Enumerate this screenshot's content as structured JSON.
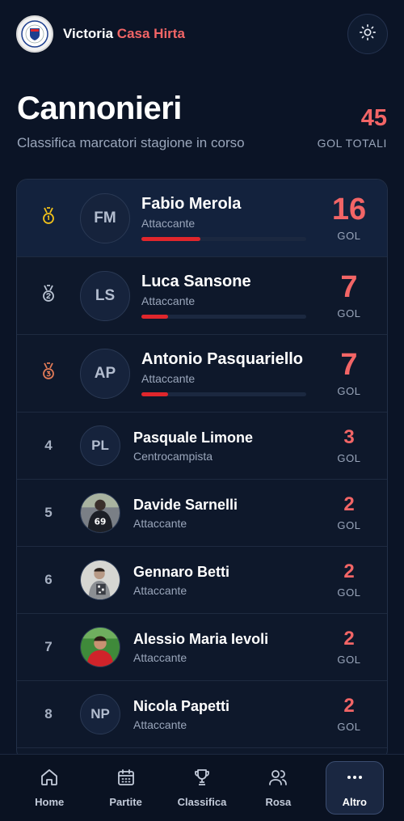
{
  "header": {
    "brand_part1": "Victoria",
    "brand_part2": "Casa Hirta",
    "logo_icon": "club-crest",
    "theme_icon": "sun-icon"
  },
  "page": {
    "title": "Cannonieri",
    "subtitle": "Classifica marcatori stagione in corso",
    "total_value": "45",
    "total_label": "GOL TOTALI"
  },
  "scorers": [
    {
      "rank": "1",
      "medal": "gold",
      "initials": "FM",
      "name": "Fabio Merola",
      "role": "Attaccante",
      "goals": "16",
      "goal_label": "GOL",
      "progress": 0.36
    },
    {
      "rank": "2",
      "medal": "silver",
      "initials": "LS",
      "name": "Luca Sansone",
      "role": "Attaccante",
      "goals": "7",
      "goal_label": "GOL",
      "progress": 0.16
    },
    {
      "rank": "3",
      "medal": "bronze",
      "initials": "AP",
      "name": "Antonio Pasquariello",
      "role": "Attaccante",
      "goals": "7",
      "goal_label": "GOL",
      "progress": 0.16
    },
    {
      "rank": "4",
      "initials": "PL",
      "name": "Pasquale Limone",
      "role": "Centrocampista",
      "goals": "3",
      "goal_label": "GOL"
    },
    {
      "rank": "5",
      "initials": "",
      "name": "Davide Sarnelli",
      "role": "Attaccante",
      "goals": "2",
      "goal_label": "GOL"
    },
    {
      "rank": "6",
      "initials": "",
      "name": "Gennaro Betti",
      "role": "Attaccante",
      "goals": "2",
      "goal_label": "GOL"
    },
    {
      "rank": "7",
      "initials": "",
      "name": "Alessio Maria Ievoli",
      "role": "Attaccante",
      "goals": "2",
      "goal_label": "GOL"
    },
    {
      "rank": "8",
      "initials": "NP",
      "name": "Nicola Papetti",
      "role": "Attaccante",
      "goals": "2",
      "goal_label": "GOL"
    }
  ],
  "colors": {
    "accent": "#f26566",
    "bar": "#e0262c",
    "gold": "#f2c21a",
    "silver": "#b9c3d3",
    "bronze": "#e07a57"
  },
  "nav": {
    "items": [
      {
        "label": "Home",
        "icon": "home-icon"
      },
      {
        "label": "Partite",
        "icon": "calendar-icon"
      },
      {
        "label": "Classifica",
        "icon": "trophy-icon"
      },
      {
        "label": "Rosa",
        "icon": "users-icon"
      },
      {
        "label": "Altro",
        "icon": "more-icon"
      }
    ],
    "active": "Altro"
  }
}
